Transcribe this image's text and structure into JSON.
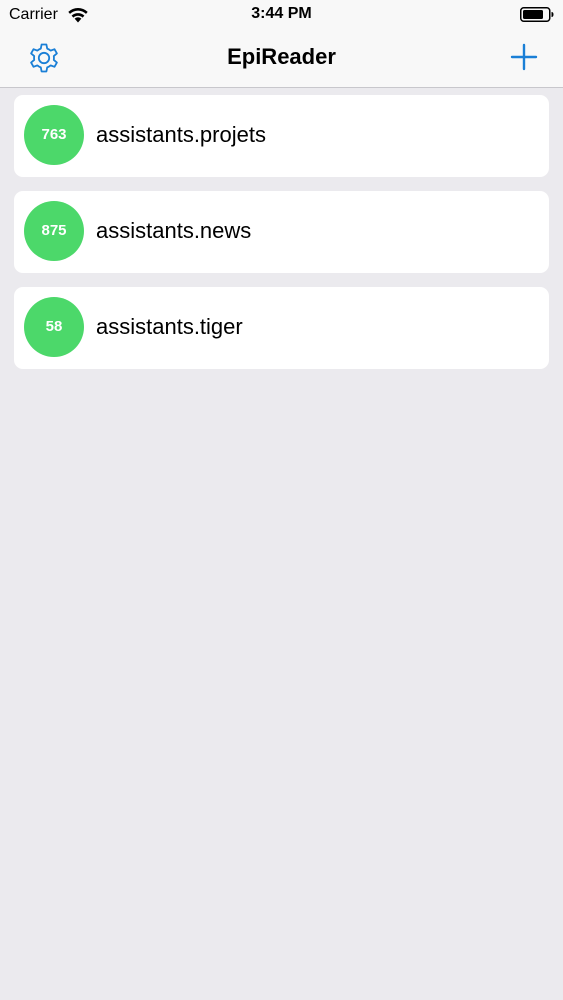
{
  "status_bar": {
    "carrier": "Carrier",
    "time": "3:44 PM",
    "wifi_icon": "wifi-icon",
    "battery_icon": "battery-icon"
  },
  "nav": {
    "title": "EpiReader",
    "settings_icon": "gear-icon",
    "add_icon": "plus-icon",
    "accent_color": "#1a7fd6"
  },
  "feeds": [
    {
      "count": "763",
      "name": "assistants.projets"
    },
    {
      "count": "875",
      "name": "assistants.news"
    },
    {
      "count": "58",
      "name": "assistants.tiger"
    }
  ],
  "colors": {
    "badge": "#4cd86a",
    "background": "#ebeaee",
    "card": "#ffffff"
  }
}
